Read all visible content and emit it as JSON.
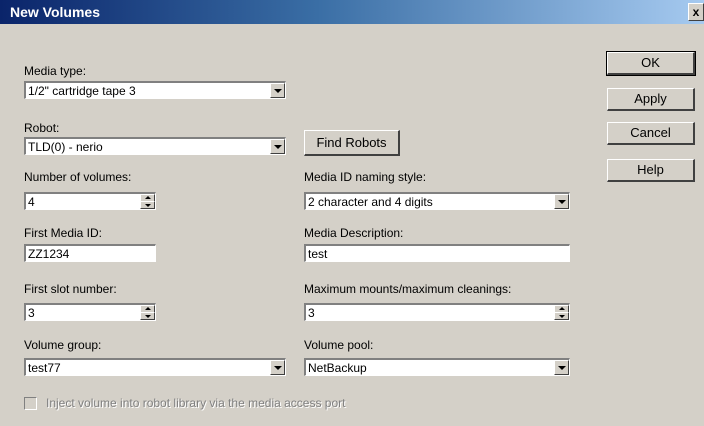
{
  "window": {
    "title": "New Volumes",
    "close_label": "x"
  },
  "media_type": {
    "label": "Media type:",
    "value": "1/2\" cartridge tape 3"
  },
  "robot": {
    "label": "Robot:",
    "value": "TLD(0) - nerio"
  },
  "find_robots_label": "Find Robots",
  "number_of_volumes": {
    "label": "Number of volumes:",
    "value": "4"
  },
  "media_id_naming_style": {
    "label": "Media ID naming style:",
    "value": "2 character  and 4 digits"
  },
  "first_media_id": {
    "label": "First Media ID:",
    "value": "ZZ1234"
  },
  "media_description": {
    "label": "Media Description:",
    "value": "test"
  },
  "first_slot_number": {
    "label": "First slot number:",
    "value": "3"
  },
  "max_mounts": {
    "label": "Maximum mounts/maximum cleanings:",
    "value": "3"
  },
  "volume_group": {
    "label": "Volume group:",
    "value": "test77"
  },
  "volume_pool": {
    "label": "Volume pool:",
    "value": "NetBackup"
  },
  "inject_checkbox": {
    "label": "Inject volume into robot library via the media access port",
    "checked": false,
    "enabled": false
  },
  "buttons": {
    "ok": "OK",
    "apply": "Apply",
    "cancel": "Cancel",
    "help": "Help"
  }
}
